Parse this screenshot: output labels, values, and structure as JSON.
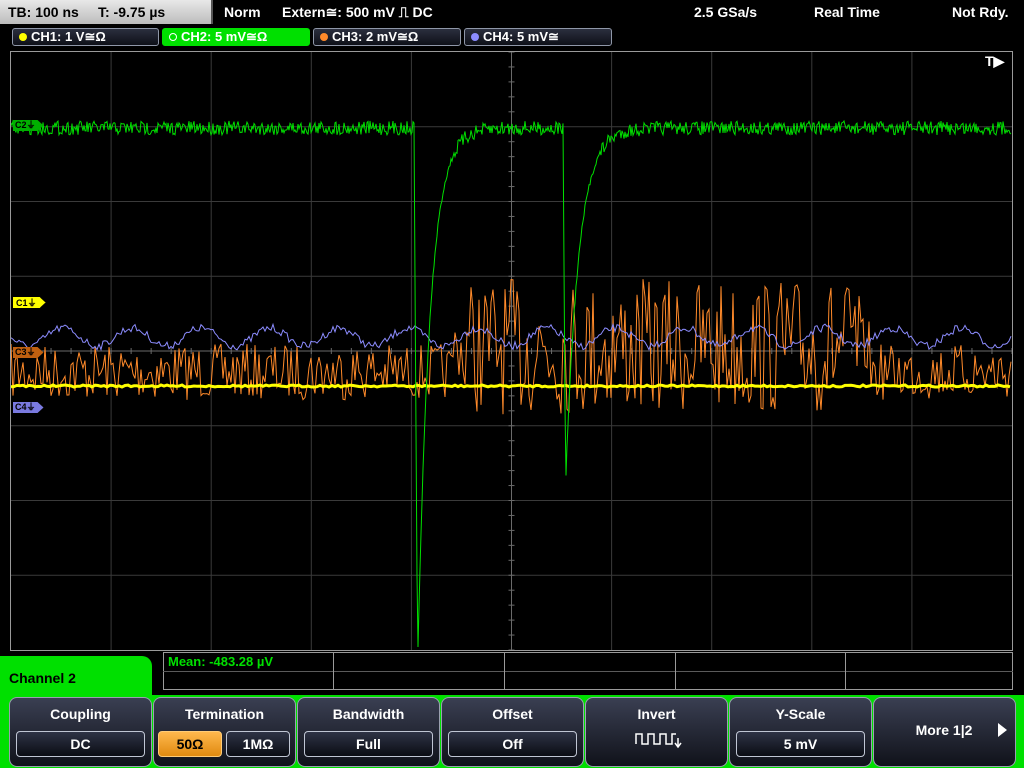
{
  "status": {
    "timebase": "TB: 100 ns",
    "trigger_time": "T: -9.75 µs",
    "mode": "Norm",
    "trigger_source": "Extern≅: 500 mV ⎍ DC",
    "sample_rate": "2.5 GSa/s",
    "acquisition": "Real Time",
    "ready_state": "Not Rdy."
  },
  "channels": [
    {
      "label": "CH1: 1 V≅Ω",
      "color": "#ffff00",
      "active": false
    },
    {
      "label": "CH2: 5 mV≅Ω",
      "color": "#00e000",
      "active": true
    },
    {
      "label": "CH3: 2 mV≅Ω",
      "color": "#ff8a2a",
      "active": false
    },
    {
      "label": "CH4: 5 mV≅",
      "color": "#8c8cff",
      "active": false
    }
  ],
  "markers": {
    "c1": "C1⏚",
    "c2": "C2⏚",
    "c3": "C3⏚",
    "c4": "C4⏚",
    "trigger": "T▶"
  },
  "measurement": {
    "label": "Mean: -483.28 µV"
  },
  "channel_menu": {
    "title": "Channel 2"
  },
  "softkeys": {
    "coupling": {
      "title": "Coupling",
      "value": "DC"
    },
    "termination": {
      "title": "Termination",
      "options": [
        "50Ω",
        "1MΩ"
      ],
      "selected": "50Ω"
    },
    "bandwidth": {
      "title": "Bandwidth",
      "value": "Full"
    },
    "offset": {
      "title": "Offset",
      "value": "Off"
    },
    "invert": {
      "title": "Invert",
      "icon": "invert-square-wave-icon"
    },
    "y_scale": {
      "title": "Y-Scale",
      "value": "5 mV"
    },
    "more": {
      "label": "More 1|2"
    }
  }
}
